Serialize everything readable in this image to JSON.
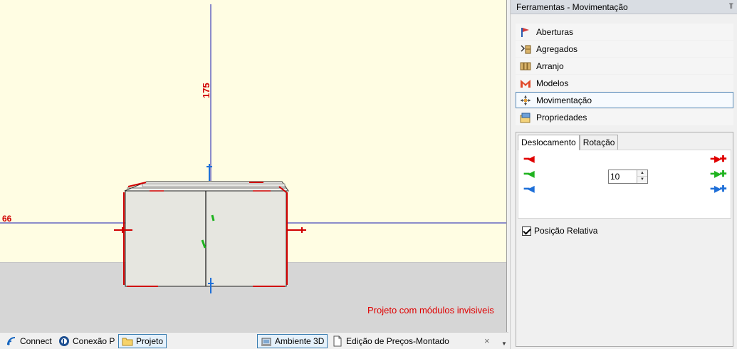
{
  "viewport": {
    "dimension_vertical": "175",
    "dimension_horizontal": "66",
    "notice": "Projeto com módulos invisiveis"
  },
  "bottom_tabs": [
    {
      "label": "Connect",
      "icon": "connect-icon"
    },
    {
      "label": "Conexão P",
      "icon": "conexao-icon"
    },
    {
      "label": "Projeto",
      "icon": "folder-icon",
      "active": true
    },
    {
      "label": "Ambiente 3D",
      "icon": "3d-environment-icon",
      "active": true
    },
    {
      "label": "Edição de Preços-Montado",
      "icon": "document-icon"
    }
  ],
  "bottom_close": "×",
  "panel": {
    "title": "Ferramentas - Movimentação",
    "pin": "⫪",
    "tools": [
      {
        "label": "Aberturas",
        "icon": "aberturas-icon"
      },
      {
        "label": "Agregados",
        "icon": "agregados-icon"
      },
      {
        "label": "Arranjo",
        "icon": "arranjo-icon"
      },
      {
        "label": "Modelos",
        "icon": "modelos-icon"
      },
      {
        "label": "Movimentação",
        "icon": "movimentacao-icon",
        "selected": true
      },
      {
        "label": "Propriedades",
        "icon": "propriedades-icon"
      }
    ],
    "tabs": [
      {
        "label": "Deslocamento",
        "active": true
      },
      {
        "label": "Rotação"
      }
    ],
    "step_value": "10",
    "checkbox_label": "Posição Relativa",
    "checkbox_checked": true
  },
  "colors": {
    "axis_x": "#e00000",
    "axis_y": "#1fb31f",
    "axis_z": "#1e6fd8",
    "selected_border": "#5a8bb8",
    "wall": "#fffde3",
    "floor": "#d6d6d6"
  }
}
